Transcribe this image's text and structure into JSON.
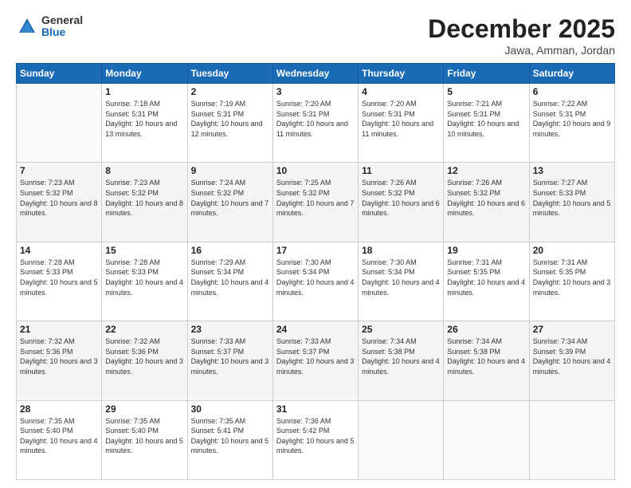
{
  "logo": {
    "general": "General",
    "blue": "Blue"
  },
  "title": "December 2025",
  "subtitle": "Jawa, Amman, Jordan",
  "days_of_week": [
    "Sunday",
    "Monday",
    "Tuesday",
    "Wednesday",
    "Thursday",
    "Friday",
    "Saturday"
  ],
  "weeks": [
    [
      {
        "day": "",
        "info": ""
      },
      {
        "day": "1",
        "info": "Sunrise: 7:18 AM\nSunset: 5:31 PM\nDaylight: 10 hours\nand 13 minutes."
      },
      {
        "day": "2",
        "info": "Sunrise: 7:19 AM\nSunset: 5:31 PM\nDaylight: 10 hours\nand 12 minutes."
      },
      {
        "day": "3",
        "info": "Sunrise: 7:20 AM\nSunset: 5:31 PM\nDaylight: 10 hours\nand 11 minutes."
      },
      {
        "day": "4",
        "info": "Sunrise: 7:20 AM\nSunset: 5:31 PM\nDaylight: 10 hours\nand 11 minutes."
      },
      {
        "day": "5",
        "info": "Sunrise: 7:21 AM\nSunset: 5:31 PM\nDaylight: 10 hours\nand 10 minutes."
      },
      {
        "day": "6",
        "info": "Sunrise: 7:22 AM\nSunset: 5:31 PM\nDaylight: 10 hours\nand 9 minutes."
      }
    ],
    [
      {
        "day": "7",
        "info": "Sunrise: 7:23 AM\nSunset: 5:32 PM\nDaylight: 10 hours\nand 8 minutes."
      },
      {
        "day": "8",
        "info": "Sunrise: 7:23 AM\nSunset: 5:32 PM\nDaylight: 10 hours\nand 8 minutes."
      },
      {
        "day": "9",
        "info": "Sunrise: 7:24 AM\nSunset: 5:32 PM\nDaylight: 10 hours\nand 7 minutes."
      },
      {
        "day": "10",
        "info": "Sunrise: 7:25 AM\nSunset: 5:32 PM\nDaylight: 10 hours\nand 7 minutes."
      },
      {
        "day": "11",
        "info": "Sunrise: 7:26 AM\nSunset: 5:32 PM\nDaylight: 10 hours\nand 6 minutes."
      },
      {
        "day": "12",
        "info": "Sunrise: 7:26 AM\nSunset: 5:32 PM\nDaylight: 10 hours\nand 6 minutes."
      },
      {
        "day": "13",
        "info": "Sunrise: 7:27 AM\nSunset: 5:33 PM\nDaylight: 10 hours\nand 5 minutes."
      }
    ],
    [
      {
        "day": "14",
        "info": "Sunrise: 7:28 AM\nSunset: 5:33 PM\nDaylight: 10 hours\nand 5 minutes."
      },
      {
        "day": "15",
        "info": "Sunrise: 7:28 AM\nSunset: 5:33 PM\nDaylight: 10 hours\nand 4 minutes."
      },
      {
        "day": "16",
        "info": "Sunrise: 7:29 AM\nSunset: 5:34 PM\nDaylight: 10 hours\nand 4 minutes."
      },
      {
        "day": "17",
        "info": "Sunrise: 7:30 AM\nSunset: 5:34 PM\nDaylight: 10 hours\nand 4 minutes."
      },
      {
        "day": "18",
        "info": "Sunrise: 7:30 AM\nSunset: 5:34 PM\nDaylight: 10 hours\nand 4 minutes."
      },
      {
        "day": "19",
        "info": "Sunrise: 7:31 AM\nSunset: 5:35 PM\nDaylight: 10 hours\nand 4 minutes."
      },
      {
        "day": "20",
        "info": "Sunrise: 7:31 AM\nSunset: 5:35 PM\nDaylight: 10 hours\nand 3 minutes."
      }
    ],
    [
      {
        "day": "21",
        "info": "Sunrise: 7:32 AM\nSunset: 5:36 PM\nDaylight: 10 hours\nand 3 minutes."
      },
      {
        "day": "22",
        "info": "Sunrise: 7:32 AM\nSunset: 5:36 PM\nDaylight: 10 hours\nand 3 minutes."
      },
      {
        "day": "23",
        "info": "Sunrise: 7:33 AM\nSunset: 5:37 PM\nDaylight: 10 hours\nand 3 minutes."
      },
      {
        "day": "24",
        "info": "Sunrise: 7:33 AM\nSunset: 5:37 PM\nDaylight: 10 hours\nand 3 minutes."
      },
      {
        "day": "25",
        "info": "Sunrise: 7:34 AM\nSunset: 5:38 PM\nDaylight: 10 hours\nand 4 minutes."
      },
      {
        "day": "26",
        "info": "Sunrise: 7:34 AM\nSunset: 5:38 PM\nDaylight: 10 hours\nand 4 minutes."
      },
      {
        "day": "27",
        "info": "Sunrise: 7:34 AM\nSunset: 5:39 PM\nDaylight: 10 hours\nand 4 minutes."
      }
    ],
    [
      {
        "day": "28",
        "info": "Sunrise: 7:35 AM\nSunset: 5:40 PM\nDaylight: 10 hours\nand 4 minutes."
      },
      {
        "day": "29",
        "info": "Sunrise: 7:35 AM\nSunset: 5:40 PM\nDaylight: 10 hours\nand 5 minutes."
      },
      {
        "day": "30",
        "info": "Sunrise: 7:35 AM\nSunset: 5:41 PM\nDaylight: 10 hours\nand 5 minutes."
      },
      {
        "day": "31",
        "info": "Sunrise: 7:36 AM\nSunset: 5:42 PM\nDaylight: 10 hours\nand 5 minutes."
      },
      {
        "day": "",
        "info": ""
      },
      {
        "day": "",
        "info": ""
      },
      {
        "day": "",
        "info": ""
      }
    ]
  ]
}
